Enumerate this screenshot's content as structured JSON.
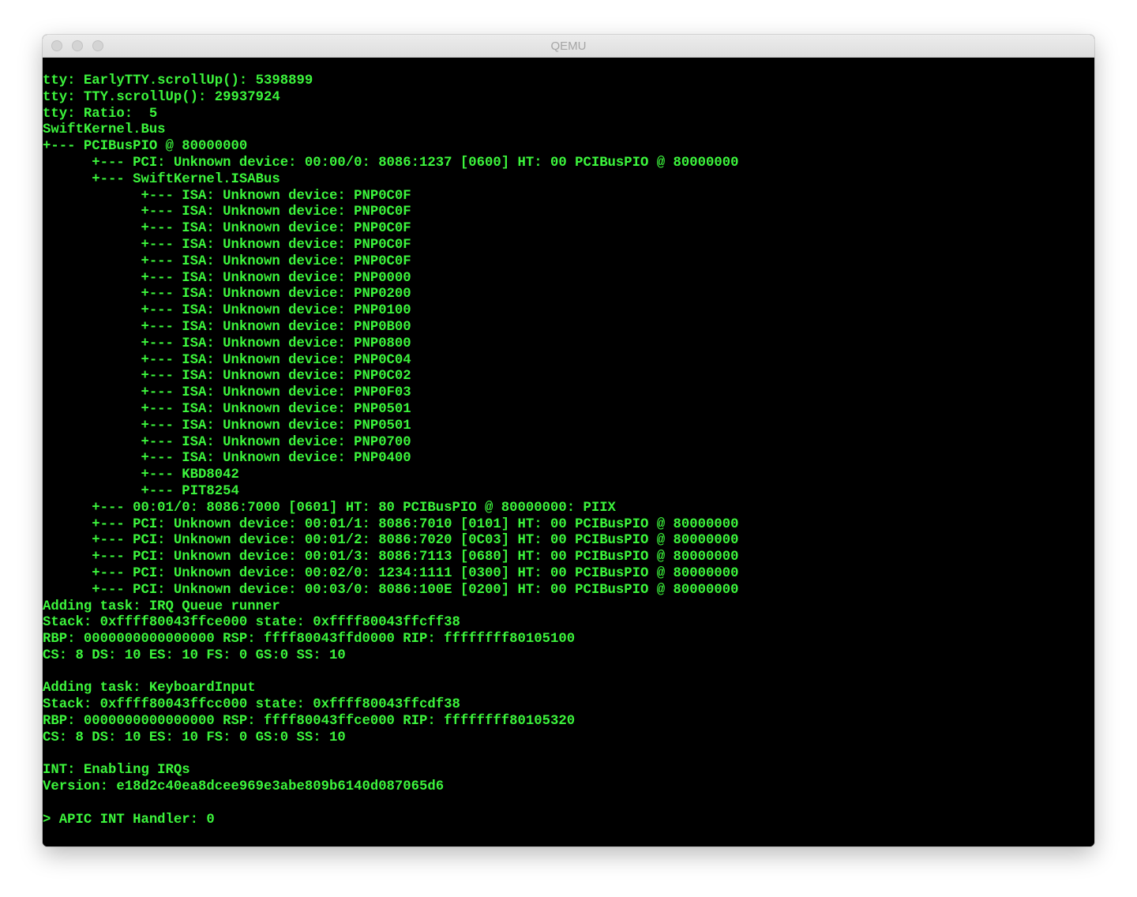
{
  "window": {
    "title": "QEMU"
  },
  "colors": {
    "terminal_bg": "#000000",
    "terminal_fg": "#3cf53c",
    "titlebar_bg": "#e6e6e6",
    "title_text": "#a5a5a5"
  },
  "console": {
    "lines": [
      "tty: EarlyTTY.scrollUp(): 5398899",
      "tty: TTY.scrollUp(): 29937924",
      "tty: Ratio:  5",
      "SwiftKernel.Bus",
      "+--- PCIBusPIO @ 80000000",
      "      +--- PCI: Unknown device: 00:00/0: 8086:1237 [0600] HT: 00 PCIBusPIO @ 80000000",
      "      +--- SwiftKernel.ISABus",
      "            +--- ISA: Unknown device: PNP0C0F",
      "            +--- ISA: Unknown device: PNP0C0F",
      "            +--- ISA: Unknown device: PNP0C0F",
      "            +--- ISA: Unknown device: PNP0C0F",
      "            +--- ISA: Unknown device: PNP0C0F",
      "            +--- ISA: Unknown device: PNP0000",
      "            +--- ISA: Unknown device: PNP0200",
      "            +--- ISA: Unknown device: PNP0100",
      "            +--- ISA: Unknown device: PNP0B00",
      "            +--- ISA: Unknown device: PNP0800",
      "            +--- ISA: Unknown device: PNP0C04",
      "            +--- ISA: Unknown device: PNP0C02",
      "            +--- ISA: Unknown device: PNP0F03",
      "            +--- ISA: Unknown device: PNP0501",
      "            +--- ISA: Unknown device: PNP0501",
      "            +--- ISA: Unknown device: PNP0700",
      "            +--- ISA: Unknown device: PNP0400",
      "            +--- KBD8042",
      "            +--- PIT8254",
      "      +--- 00:01/0: 8086:7000 [0601] HT: 80 PCIBusPIO @ 80000000: PIIX",
      "      +--- PCI: Unknown device: 00:01/1: 8086:7010 [0101] HT: 00 PCIBusPIO @ 80000000",
      "      +--- PCI: Unknown device: 00:01/2: 8086:7020 [0C03] HT: 00 PCIBusPIO @ 80000000",
      "      +--- PCI: Unknown device: 00:01/3: 8086:7113 [0680] HT: 00 PCIBusPIO @ 80000000",
      "      +--- PCI: Unknown device: 00:02/0: 1234:1111 [0300] HT: 00 PCIBusPIO @ 80000000",
      "      +--- PCI: Unknown device: 00:03/0: 8086:100E [0200] HT: 00 PCIBusPIO @ 80000000",
      "Adding task: IRQ Queue runner",
      "Stack: 0xffff80043ffce000 state: 0xffff80043ffcff38",
      "RBP: 0000000000000000 RSP: ffff80043ffd0000 RIP: ffffffff80105100",
      "CS: 8 DS: 10 ES: 10 FS: 0 GS:0 SS: 10",
      "",
      "Adding task: KeyboardInput",
      "Stack: 0xffff80043ffcc000 state: 0xffff80043ffcdf38",
      "RBP: 0000000000000000 RSP: ffff80043ffce000 RIP: ffffffff80105320",
      "CS: 8 DS: 10 ES: 10 FS: 0 GS:0 SS: 10",
      "",
      "INT: Enabling IRQs",
      "Version: e18d2c40ea8dcee969e3abe809b6140d087065d6",
      "",
      "> APIC INT Handler: 0"
    ]
  }
}
